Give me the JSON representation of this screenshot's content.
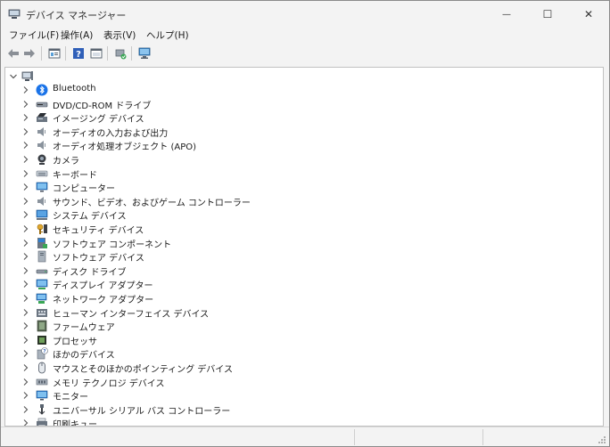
{
  "window": {
    "title": "デバイス マネージャー",
    "minimize_glyph": "—",
    "maximize_glyph": "☐",
    "close_glyph": "✕"
  },
  "menu": [
    {
      "label": "ファイル(F)"
    },
    {
      "label": "操作(A)"
    },
    {
      "label": "表示(V)"
    },
    {
      "label": "ヘルプ(H)"
    }
  ],
  "toolbar": {
    "buttons": [
      "back-arrow-icon",
      "forward-arrow-icon",
      "properties-icon",
      "help-icon",
      "console-tree-icon",
      "update-driver-icon",
      "scan-hardware-icon"
    ]
  },
  "tree": {
    "root_icon": "computer-icon",
    "categories": [
      {
        "label": "Bluetooth",
        "icon": "bluetooth-icon"
      },
      {
        "label": "DVD/CD-ROM ドライブ",
        "icon": "dvd-drive-icon"
      },
      {
        "label": "イメージング デバイス",
        "icon": "imaging-device-icon"
      },
      {
        "label": "オーディオの入力および出力",
        "icon": "speaker-icon"
      },
      {
        "label": "オーディオ処理オブジェクト (APO)",
        "icon": "speaker-icon"
      },
      {
        "label": "カメラ",
        "icon": "camera-icon"
      },
      {
        "label": "キーボード",
        "icon": "keyboard-icon"
      },
      {
        "label": "コンピューター",
        "icon": "monitor-icon"
      },
      {
        "label": "サウンド、ビデオ、およびゲーム コントローラー",
        "icon": "speaker-icon"
      },
      {
        "label": "システム デバイス",
        "icon": "system-device-icon"
      },
      {
        "label": "セキュリティ デバイス",
        "icon": "security-key-icon"
      },
      {
        "label": "ソフトウェア コンポーネント",
        "icon": "software-component-icon"
      },
      {
        "label": "ソフトウェア デバイス",
        "icon": "software-device-icon"
      },
      {
        "label": "ディスク ドライブ",
        "icon": "disk-drive-icon"
      },
      {
        "label": "ディスプレイ アダプター",
        "icon": "display-adapter-icon"
      },
      {
        "label": "ネットワーク アダプター",
        "icon": "network-adapter-icon"
      },
      {
        "label": "ヒューマン インターフェイス デバイス",
        "icon": "hid-icon"
      },
      {
        "label": "ファームウェア",
        "icon": "firmware-icon"
      },
      {
        "label": "プロセッサ",
        "icon": "processor-icon"
      },
      {
        "label": "ほかのデバイス",
        "icon": "other-device-icon"
      },
      {
        "label": "マウスとそのほかのポインティング デバイス",
        "icon": "mouse-icon"
      },
      {
        "label": "メモリ テクノロジ デバイス",
        "icon": "memory-icon"
      },
      {
        "label": "モニター",
        "icon": "monitor-icon"
      },
      {
        "label": "ユニバーサル シリアル バス コントローラー",
        "icon": "usb-icon"
      },
      {
        "label": "印刷キュー",
        "icon": "printer-icon"
      }
    ]
  },
  "colors": {
    "accent": "#0078d4",
    "chevron": "#555555"
  }
}
